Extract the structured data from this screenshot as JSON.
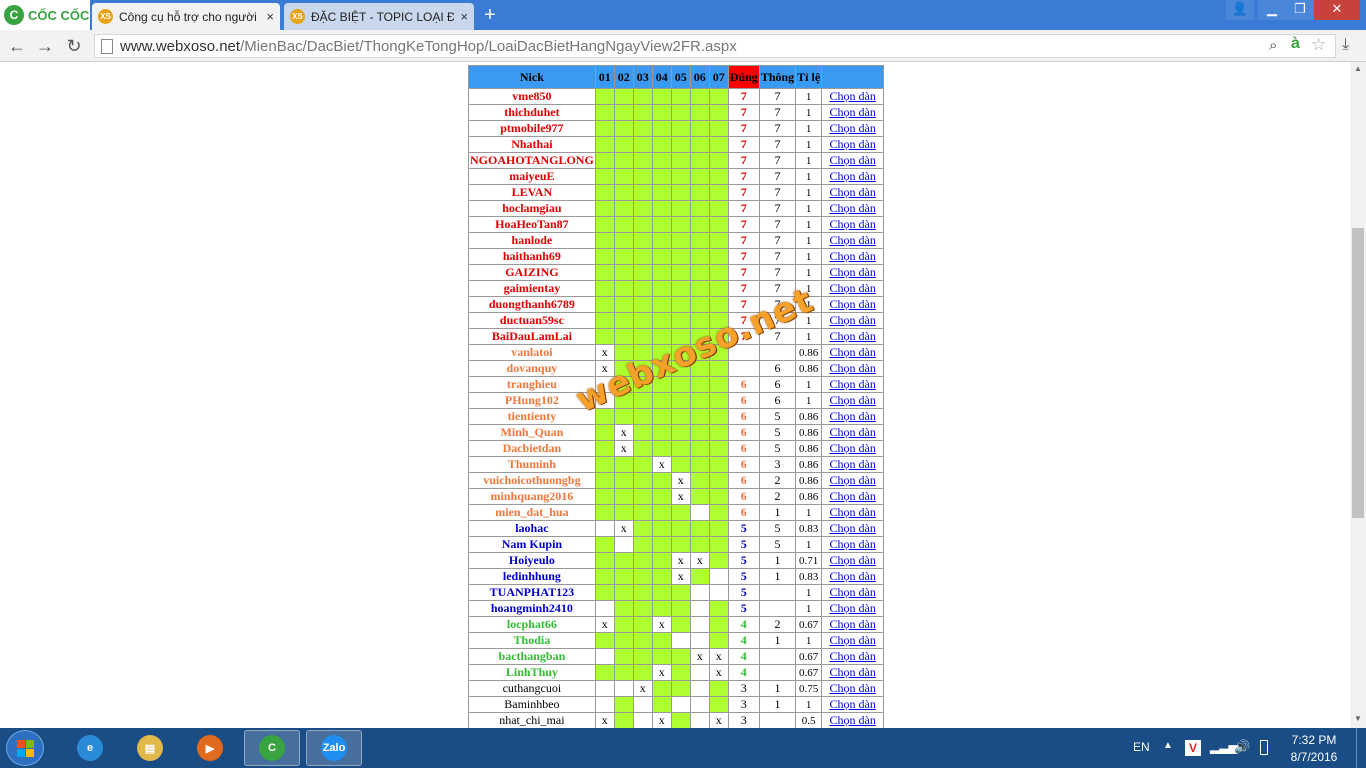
{
  "browser": {
    "brand_logo_glyph": "C",
    "brand_name": "CỐC CỐC",
    "tabs": [
      {
        "favicon": "XS",
        "title": "Công cụ hỗ trợ cho người chơi",
        "close": "×"
      },
      {
        "favicon": "XS",
        "title": "ĐẶC BIỆT - TOPIC LOẠI ĐẦU",
        "close": "×"
      }
    ],
    "new_tab_glyph": "+",
    "window_buttons": {
      "user": "👤",
      "minimize": "▁",
      "maximize": "❐",
      "close": "✕"
    },
    "nav": {
      "back": "←",
      "forward": "→",
      "reload": "↻"
    },
    "url_prefix": "www.webxoso.net",
    "url_path": "/MienBac/DacBiet/ThongKeTongHop/LoaiDacBietHangNgayView2FR.aspx",
    "zoom_glyph": "⌕",
    "dict_glyph": "à",
    "star_glyph": "☆",
    "download_glyph": "⤓",
    "scroll_up": "▲",
    "scroll_down": "▼"
  },
  "table": {
    "headers": [
      "Nick",
      "01",
      "02",
      "03",
      "04",
      "05",
      "06",
      "07",
      "Đúng",
      "Thông",
      "Tỉ lệ",
      ""
    ],
    "link_label": "Chọn dàn",
    "rows": [
      {
        "nick": "vme850",
        "color": "red",
        "cells": [
          "g",
          "g",
          "g",
          "g",
          "g",
          "g",
          "g"
        ],
        "dung": "7",
        "thong": "7",
        "tile": "1"
      },
      {
        "nick": "thichduhet",
        "color": "red",
        "cells": [
          "g",
          "g",
          "g",
          "g",
          "g",
          "g",
          "g"
        ],
        "dung": "7",
        "thong": "7",
        "tile": "1"
      },
      {
        "nick": "ptmobile977",
        "color": "red",
        "cells": [
          "g",
          "g",
          "g",
          "g",
          "g",
          "g",
          "g"
        ],
        "dung": "7",
        "thong": "7",
        "tile": "1"
      },
      {
        "nick": "Nhathai",
        "color": "red",
        "cells": [
          "g",
          "g",
          "g",
          "g",
          "g",
          "g",
          "g"
        ],
        "dung": "7",
        "thong": "7",
        "tile": "1"
      },
      {
        "nick": "NGOAHOTANGLONG",
        "color": "red",
        "cells": [
          "g",
          "g",
          "g",
          "g",
          "g",
          "g",
          "g"
        ],
        "dung": "7",
        "thong": "7",
        "tile": "1"
      },
      {
        "nick": "maiyeuE",
        "color": "red",
        "cells": [
          "g",
          "g",
          "g",
          "g",
          "g",
          "g",
          "g"
        ],
        "dung": "7",
        "thong": "7",
        "tile": "1"
      },
      {
        "nick": "LEVAN",
        "color": "red",
        "cells": [
          "g",
          "g",
          "g",
          "g",
          "g",
          "g",
          "g"
        ],
        "dung": "7",
        "thong": "7",
        "tile": "1"
      },
      {
        "nick": "hoclamgiau",
        "color": "red",
        "cells": [
          "g",
          "g",
          "g",
          "g",
          "g",
          "g",
          "g"
        ],
        "dung": "7",
        "thong": "7",
        "tile": "1"
      },
      {
        "nick": "HoaHeoTan87",
        "color": "red",
        "cells": [
          "g",
          "g",
          "g",
          "g",
          "g",
          "g",
          "g"
        ],
        "dung": "7",
        "thong": "7",
        "tile": "1"
      },
      {
        "nick": "hanlode",
        "color": "red",
        "cells": [
          "g",
          "g",
          "g",
          "g",
          "g",
          "g",
          "g"
        ],
        "dung": "7",
        "thong": "7",
        "tile": "1"
      },
      {
        "nick": "haithanh69",
        "color": "red",
        "cells": [
          "g",
          "g",
          "g",
          "g",
          "g",
          "g",
          "g"
        ],
        "dung": "7",
        "thong": "7",
        "tile": "1"
      },
      {
        "nick": "GAIZING",
        "color": "red",
        "cells": [
          "g",
          "g",
          "g",
          "g",
          "g",
          "g",
          "g"
        ],
        "dung": "7",
        "thong": "7",
        "tile": "1"
      },
      {
        "nick": "gaimientay",
        "color": "red",
        "cells": [
          "g",
          "g",
          "g",
          "g",
          "g",
          "g",
          "g"
        ],
        "dung": "7",
        "thong": "7",
        "tile": "1"
      },
      {
        "nick": "duongthanh6789",
        "color": "red",
        "cells": [
          "g",
          "g",
          "g",
          "g",
          "g",
          "g",
          "g"
        ],
        "dung": "7",
        "thong": "7",
        "tile": "1"
      },
      {
        "nick": "ductuan59sc",
        "color": "red",
        "cells": [
          "g",
          "g",
          "g",
          "g",
          "g",
          "g",
          "g"
        ],
        "dung": "7",
        "thong": "7",
        "tile": "1"
      },
      {
        "nick": "BaiDauLamLai",
        "color": "red",
        "cells": [
          "g",
          "g",
          "g",
          "g",
          "g",
          "g",
          "g"
        ],
        "dung": "7",
        "thong": "7",
        "tile": "1"
      },
      {
        "nick": "vanlatoi",
        "color": "orange",
        "cells": [
          "x",
          "g",
          "g",
          "g",
          "g",
          "g",
          "g"
        ],
        "dung": "",
        "thong": "",
        "tile": "0.86"
      },
      {
        "nick": "dovanquy",
        "color": "orange",
        "cells": [
          "x",
          "g",
          "g",
          "g",
          "g",
          "g",
          "g"
        ],
        "dung": "",
        "thong": "6",
        "tile": "0.86"
      },
      {
        "nick": "tranghieu",
        "color": "orange",
        "cells": [
          "w",
          "g",
          "g",
          "g",
          "g",
          "g",
          "g"
        ],
        "dung": "6",
        "thong": "6",
        "tile": "1"
      },
      {
        "nick": "PHung102",
        "color": "orange",
        "cells": [
          "w",
          "g",
          "g",
          "g",
          "g",
          "g",
          "g"
        ],
        "dung": "6",
        "thong": "6",
        "tile": "1"
      },
      {
        "nick": "tientienty",
        "color": "orange",
        "cells": [
          "g",
          "g",
          "g",
          "g",
          "g",
          "g",
          "g"
        ],
        "dung": "6",
        "thong": "5",
        "tile": "0.86"
      },
      {
        "nick": "Minh_Quan",
        "color": "orange",
        "cells": [
          "g",
          "x",
          "g",
          "g",
          "g",
          "g",
          "g"
        ],
        "dung": "6",
        "thong": "5",
        "tile": "0.86"
      },
      {
        "nick": "Dacbietdan",
        "color": "orange",
        "cells": [
          "g",
          "x",
          "g",
          "g",
          "g",
          "g",
          "g"
        ],
        "dung": "6",
        "thong": "5",
        "tile": "0.86"
      },
      {
        "nick": "Thuminh",
        "color": "orange",
        "cells": [
          "g",
          "g",
          "g",
          "x",
          "g",
          "g",
          "g"
        ],
        "dung": "6",
        "thong": "3",
        "tile": "0.86"
      },
      {
        "nick": "vuichoicothuongbg",
        "color": "orange",
        "cells": [
          "g",
          "g",
          "g",
          "g",
          "x",
          "g",
          "g"
        ],
        "dung": "6",
        "thong": "2",
        "tile": "0.86"
      },
      {
        "nick": "minhquang2016",
        "color": "orange",
        "cells": [
          "g",
          "g",
          "g",
          "g",
          "x",
          "g",
          "g"
        ],
        "dung": "6",
        "thong": "2",
        "tile": "0.86"
      },
      {
        "nick": "mien_dat_hua",
        "color": "orange",
        "cells": [
          "g",
          "g",
          "g",
          "g",
          "g",
          "w",
          "g"
        ],
        "dung": "6",
        "thong": "1",
        "tile": "1"
      },
      {
        "nick": "laohac",
        "color": "blue",
        "cells": [
          "w",
          "x",
          "g",
          "g",
          "g",
          "g",
          "g"
        ],
        "dung": "5",
        "thong": "5",
        "tile": "0.83"
      },
      {
        "nick": "Nam Kupin",
        "color": "blue",
        "cells": [
          "g",
          "w",
          "g",
          "g",
          "g",
          "g",
          "g"
        ],
        "dung": "5",
        "thong": "5",
        "tile": "1"
      },
      {
        "nick": "Hoiyeulo",
        "color": "blue",
        "cells": [
          "g",
          "g",
          "g",
          "g",
          "x",
          "x",
          "g"
        ],
        "dung": "5",
        "thong": "1",
        "tile": "0.71"
      },
      {
        "nick": "ledinhhung",
        "color": "blue",
        "cells": [
          "g",
          "g",
          "g",
          "g",
          "x",
          "g",
          "w"
        ],
        "dung": "5",
        "thong": "1",
        "tile": "0.83"
      },
      {
        "nick": "TUANPHAT123",
        "color": "blue",
        "cells": [
          "g",
          "g",
          "g",
          "g",
          "g",
          "w",
          "w"
        ],
        "dung": "5",
        "thong": "",
        "tile": "1"
      },
      {
        "nick": "hoangminh2410",
        "color": "blue",
        "cells": [
          "w",
          "g",
          "g",
          "g",
          "g",
          "w",
          "g"
        ],
        "dung": "5",
        "thong": "",
        "tile": "1"
      },
      {
        "nick": "locphat66",
        "color": "green",
        "cells": [
          "x",
          "g",
          "g",
          "x",
          "g",
          "w",
          "g"
        ],
        "dung": "4",
        "thong": "2",
        "tile": "0.67"
      },
      {
        "nick": "Thodia",
        "color": "green",
        "cells": [
          "g",
          "g",
          "g",
          "g",
          "w",
          "w",
          "g"
        ],
        "dung": "4",
        "thong": "1",
        "tile": "1"
      },
      {
        "nick": "bacthangban",
        "color": "green",
        "cells": [
          "w",
          "g",
          "g",
          "g",
          "g",
          "x",
          "x"
        ],
        "dung": "4",
        "thong": "",
        "tile": "0.67"
      },
      {
        "nick": "LinhThuy",
        "color": "green",
        "cells": [
          "g",
          "g",
          "g",
          "x",
          "g",
          "w",
          "x"
        ],
        "dung": "4",
        "thong": "",
        "tile": "0.67"
      },
      {
        "nick": "cuthangcuoi",
        "color": "black",
        "cells": [
          "w",
          "w",
          "x",
          "g",
          "g",
          "w",
          "g"
        ],
        "dung": "3",
        "thong": "1",
        "tile": "0.75"
      },
      {
        "nick": "Baminhbeo",
        "color": "black",
        "cells": [
          "w",
          "g",
          "w",
          "g",
          "w",
          "w",
          "g"
        ],
        "dung": "3",
        "thong": "1",
        "tile": "1"
      },
      {
        "nick": "nhat_chi_mai",
        "color": "black",
        "cells": [
          "x",
          "g",
          "w",
          "x",
          "g",
          "w",
          "x"
        ],
        "dung": "3",
        "thong": "",
        "tile": "0.5"
      }
    ]
  },
  "watermark": "webxoso.net",
  "taskbar": {
    "apps": [
      {
        "name": "ie",
        "glyph": "e",
        "color": "#2a8bd8"
      },
      {
        "name": "explorer",
        "glyph": "▤",
        "color": "#e1b84a"
      },
      {
        "name": "media",
        "glyph": "▶",
        "color": "#e06a1e"
      },
      {
        "name": "coccoc",
        "glyph": "C",
        "color": "#3aa341"
      },
      {
        "name": "zalo",
        "glyph": "Zalo",
        "color": "#1e8ef0"
      }
    ],
    "lang": "EN",
    "tray_arrow": "▲",
    "vivo_glyph": "V",
    "signal_glyph": "▂▃▅",
    "volume_glyph": "🔊",
    "time": "7:32 PM",
    "date": "8/7/2016"
  }
}
